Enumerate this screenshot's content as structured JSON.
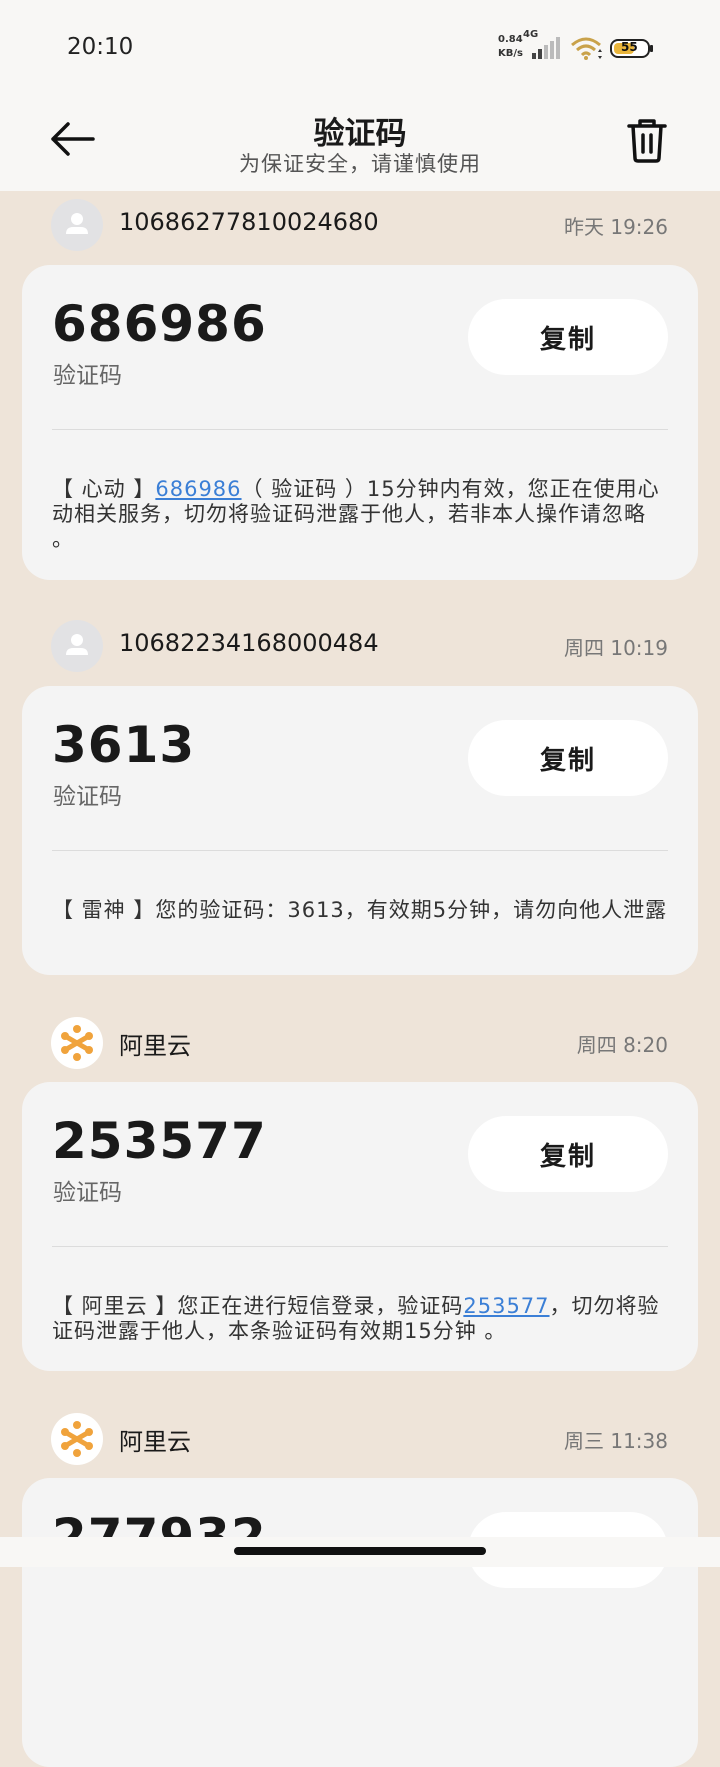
{
  "status_bar": {
    "time": "20:10",
    "net_speed_value": "0.84",
    "net_speed_unit": "KB/s",
    "net_type": "4G",
    "battery": "55"
  },
  "header": {
    "title": "验证码",
    "subtitle": "为保证安全，请谨慎使用"
  },
  "messages": [
    {
      "sender": "10686277810024680",
      "time": "昨天 19:26",
      "code": "686986",
      "code_label": "验证码",
      "copy_label": "复制",
      "body_pre": "【 心动 】",
      "body_code": "686986",
      "body_post": "（ 验证码 ）15分钟内有效，您正在使用心动相关服务，切勿将验证码泄露于他人，若非本人操作请忽略 。"
    },
    {
      "sender": "10682234168000484",
      "time": "周四 10:19",
      "code": "3613",
      "code_label": "验证码",
      "copy_label": "复制",
      "body_pre": "【 雷神 】您的验证码：3613，有效期5分钟，请勿向他人泄露",
      "body_code": "",
      "body_post": ""
    },
    {
      "sender": "阿里云",
      "time": "周四 8:20",
      "code": "253577",
      "code_label": "验证码",
      "copy_label": "复制",
      "body_pre": "【 阿里云 】您正在进行短信登录，验证码",
      "body_code": "253577",
      "body_post": "，切勿将验证码泄露于他人，本条验证码有效期15分钟 。"
    },
    {
      "sender": "阿里云",
      "time": "周三 11:38",
      "code": "277932",
      "code_label": "",
      "copy_label": "",
      "body_pre": "",
      "body_code": "",
      "body_post": ""
    }
  ],
  "colors": {
    "background": "#eee4d9",
    "card": "#f4f4f4",
    "link": "#3b7fd6",
    "aliyun_brand": "#f0a33c"
  },
  "icons": [
    "back-arrow-icon",
    "trash-icon",
    "default-avatar-icon",
    "aliyun-logo-icon",
    "signal-icon",
    "wifi-icon",
    "battery-icon"
  ]
}
